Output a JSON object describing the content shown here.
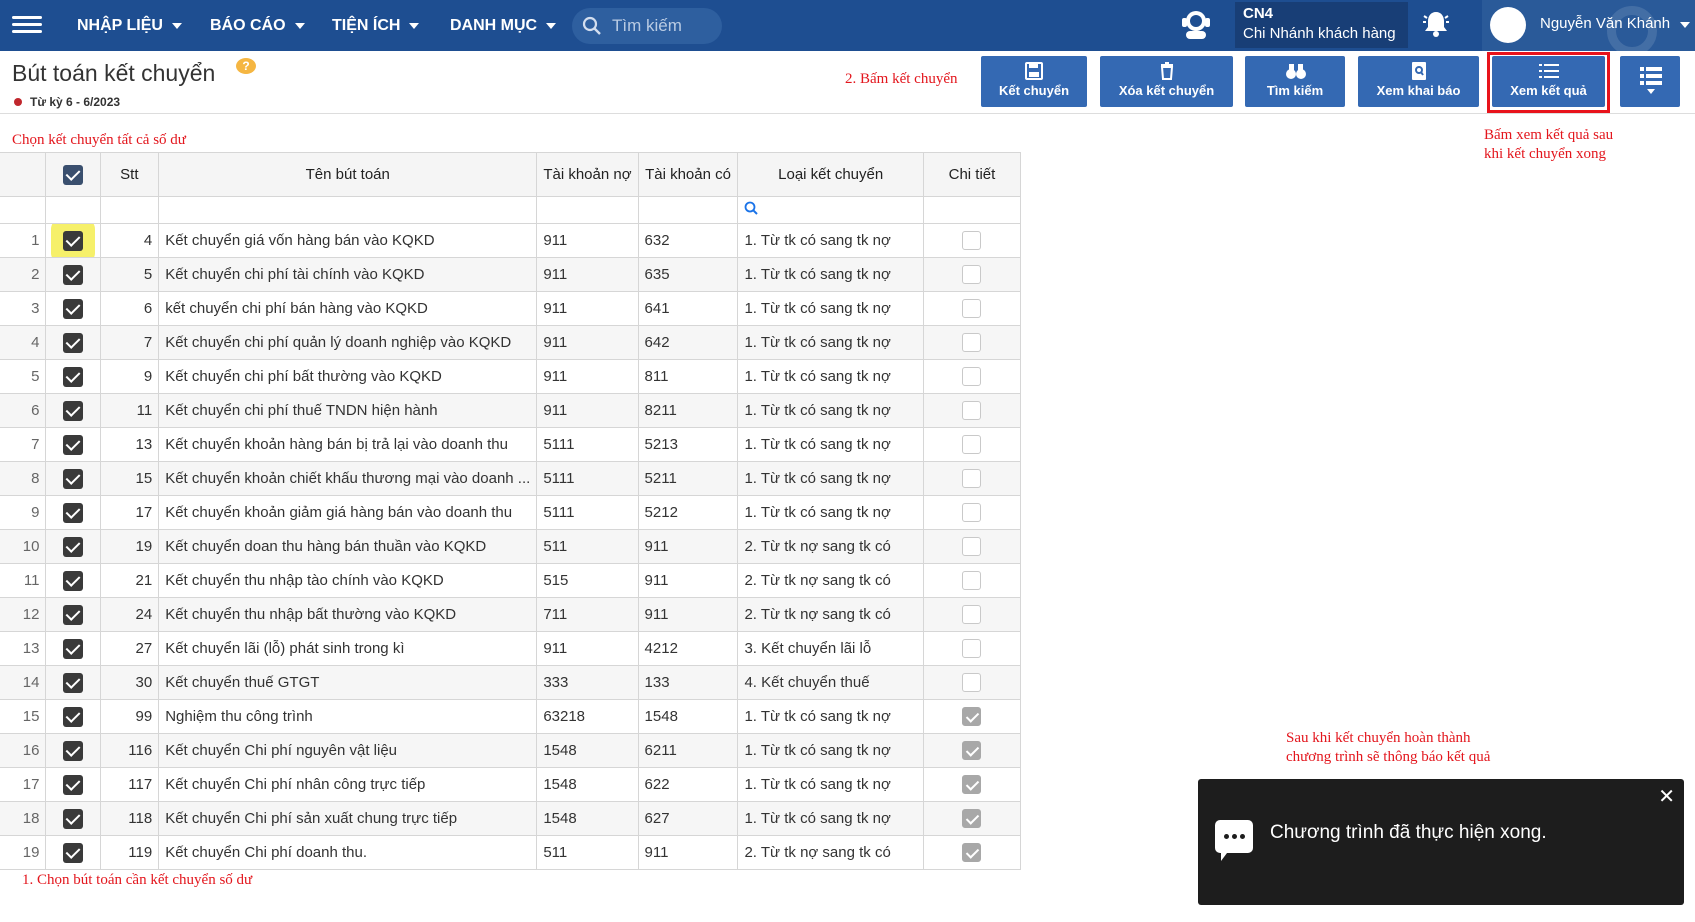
{
  "nav": {
    "menus": [
      "NHẬP LIỆU",
      "BÁO CÁO",
      "TIỆN ÍCH",
      "DANH MỤC"
    ],
    "search_placeholder": "Tìm kiếm",
    "branch_code": "CN4",
    "branch_name": "Chi Nhánh khách hàng",
    "user_name": "Nguyễn Văn Khánh"
  },
  "page": {
    "title": "Bút toán kết chuyển",
    "period": "Từ kỳ 6 - 6/2023"
  },
  "toolbar": {
    "buttons": [
      "Kết chuyển",
      "Xóa kết chuyển",
      "Tìm kiếm",
      "Xem khai báo",
      "Xem kết quả"
    ]
  },
  "annotations": {
    "step2": "2. Bấm kết chuyển",
    "select_all": "Chọn kết chuyển tất cả số dư",
    "view_result": [
      "Bấm xem kết quả sau",
      "khi kết chuyển xong"
    ],
    "step1": "1. Chọn bút toán cần kết chuyển số dư",
    "done": [
      "Sau khi kết chuyển hoàn thành",
      "chương trình sẽ thông báo kết quả"
    ]
  },
  "table": {
    "headers": {
      "stt": "Stt",
      "ten": "Tên bút toán",
      "tk_no": "Tài khoản nợ",
      "tk_co": "Tài khoản có",
      "loai": "Loại kết chuyển",
      "chi_tiet": "Chi tiết"
    },
    "rows": [
      {
        "n": "1",
        "stt": "4",
        "ten": "Kết chuyển giá vốn hàng bán vào KQKD",
        "no": "911",
        "co": "632",
        "loai": "1. Từ tk có sang tk nợ",
        "ct": false
      },
      {
        "n": "2",
        "stt": "5",
        "ten": "Kết chuyển chi phí tài chính vào KQKD",
        "no": "911",
        "co": "635",
        "loai": "1. Từ tk có sang tk nợ",
        "ct": false
      },
      {
        "n": "3",
        "stt": "6",
        "ten": "kết chuyển chi phí bán hàng vào KQKD",
        "no": "911",
        "co": "641",
        "loai": "1. Từ tk có sang tk nợ",
        "ct": false
      },
      {
        "n": "4",
        "stt": "7",
        "ten": "Kết chuyển chi phí quản lý doanh nghiệp vào KQKD",
        "no": "911",
        "co": "642",
        "loai": "1. Từ tk có sang tk nợ",
        "ct": false
      },
      {
        "n": "5",
        "stt": "9",
        "ten": "Kết chuyển chi phí bất thường vào KQKD",
        "no": "911",
        "co": "811",
        "loai": "1. Từ tk có sang tk nợ",
        "ct": false
      },
      {
        "n": "6",
        "stt": "11",
        "ten": "Kết chuyển chi phí thuế TNDN hiện hành",
        "no": "911",
        "co": "8211",
        "loai": "1. Từ tk có sang tk nợ",
        "ct": false
      },
      {
        "n": "7",
        "stt": "13",
        "ten": "Kết chuyển khoản hàng bán bị trả lại vào doanh thu",
        "no": "5111",
        "co": "5213",
        "loai": "1. Từ tk có sang tk nợ",
        "ct": false
      },
      {
        "n": "8",
        "stt": "15",
        "ten": "Kết chuyển khoản chiết khấu thương mại vào doanh ...",
        "no": "5111",
        "co": "5211",
        "loai": "1. Từ tk có sang tk nợ",
        "ct": false
      },
      {
        "n": "9",
        "stt": "17",
        "ten": "Kết chuyển khoản giảm giá hàng bán vào doanh thu",
        "no": "5111",
        "co": "5212",
        "loai": "1. Từ tk có sang tk nợ",
        "ct": false
      },
      {
        "n": "10",
        "stt": "19",
        "ten": "Kết chuyển doan thu hàng bán thuần vào KQKD",
        "no": "511",
        "co": "911",
        "loai": "2. Từ tk nợ sang tk có",
        "ct": false
      },
      {
        "n": "11",
        "stt": "21",
        "ten": "Kết chuyển thu nhập tào chính vào KQKD",
        "no": "515",
        "co": "911",
        "loai": "2. Từ tk nợ sang tk có",
        "ct": false
      },
      {
        "n": "12",
        "stt": "24",
        "ten": "Kết chuyển thu nhập bất thường vào KQKD",
        "no": "711",
        "co": "911",
        "loai": "2. Từ tk nợ sang tk có",
        "ct": false
      },
      {
        "n": "13",
        "stt": "27",
        "ten": "Kết chuyển lãi (lỗ) phát sinh trong kì",
        "no": "911",
        "co": "4212",
        "loai": "3. Kết chuyển lãi lỗ",
        "ct": false
      },
      {
        "n": "14",
        "stt": "30",
        "ten": "Kết chuyển thuế GTGT",
        "no": "333",
        "co": "133",
        "loai": "4. Kết chuyển thuế",
        "ct": false
      },
      {
        "n": "15",
        "stt": "99",
        "ten": "Nghiệm thu công trình",
        "no": "63218",
        "co": "1548",
        "loai": "1. Từ tk có sang tk nợ",
        "ct": true
      },
      {
        "n": "16",
        "stt": "116",
        "ten": "Kết chuyển Chi phí nguyên vật liệu",
        "no": "1548",
        "co": "6211",
        "loai": "1. Từ tk có sang tk nợ",
        "ct": true
      },
      {
        "n": "17",
        "stt": "117",
        "ten": "Kết chuyển Chi phí nhân công trực tiếp",
        "no": "1548",
        "co": "622",
        "loai": "1. Từ tk có sang tk nợ",
        "ct": true
      },
      {
        "n": "18",
        "stt": "118",
        "ten": "Kết chuyển Chi phí sản xuất chung trực tiếp",
        "no": "1548",
        "co": "627",
        "loai": "1. Từ tk có sang tk nợ",
        "ct": true
      },
      {
        "n": "19",
        "stt": "119",
        "ten": "Kết chuyển Chi phí doanh thu.",
        "no": "511",
        "co": "911",
        "loai": "2. Từ tk nợ sang tk có",
        "ct": true
      }
    ]
  },
  "toast": {
    "message": "Chương trình đã thực hiện xong.",
    "close": "✕"
  },
  "colors": {
    "navbar": "#1e4e91",
    "button": "#3469b3",
    "annotation": "#e3161d"
  }
}
